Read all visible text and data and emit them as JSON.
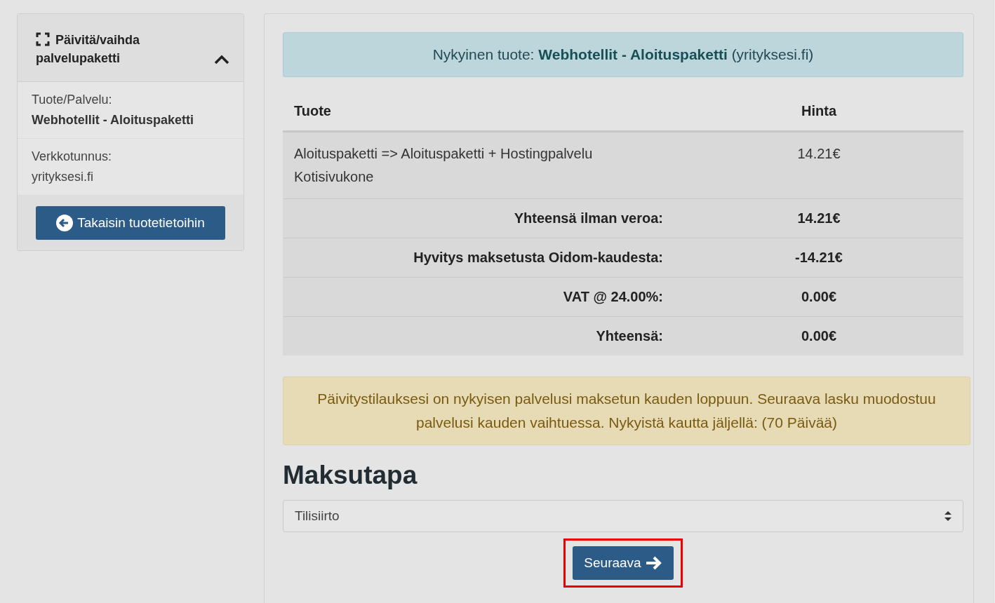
{
  "sidebar": {
    "title": "Päivitä/vaihda palvelupaketti",
    "expanded": true,
    "fields": [
      {
        "label": "Tuote/Palvelu:",
        "value": "Webhotellit - Aloituspaketti",
        "bold": true
      },
      {
        "label": "Verkkotunnus:",
        "value": "yrityksesi.fi",
        "bold": false
      }
    ],
    "back_button": "Takaisin tuotetietoihin"
  },
  "info_alert": "Nykyinen tuote: **Webhotellit - Aloituspaketti** (yrityksesi.fi)",
  "table": {
    "columns": [
      "Tuote",
      "Hinta"
    ],
    "rows": [
      {
        "kind": "item",
        "description": [
          "Aloituspaketti => Aloituspaketti + Hostingpalvelu",
          "Kotisivukone"
        ],
        "price": "14.21€"
      },
      {
        "kind": "total",
        "label": "Yhteensä ilman veroa:",
        "price": "14.21€"
      },
      {
        "kind": "total",
        "label": "Hyvitys maksetusta Oidom-kaudesta:",
        "price": "-14.21€"
      },
      {
        "kind": "total",
        "label": "VAT @ 24.00%:",
        "price": "0.00€"
      },
      {
        "kind": "total",
        "label": "Yhteensä:",
        "price": "0.00€"
      }
    ]
  },
  "warning_alert": "Päivitystilauksesi on nykyisen palvelusi maksetun kauden loppuun. Seuraava lasku muodostuu palvelusi kauden vaihtuessa. Nykyistä kautta jäljellä: (70 Päivää)",
  "payment": {
    "heading": "Maksutapa",
    "method": "Tilisiirto"
  },
  "next_button": {
    "label": "Seuraava",
    "highlighted": true
  }
}
